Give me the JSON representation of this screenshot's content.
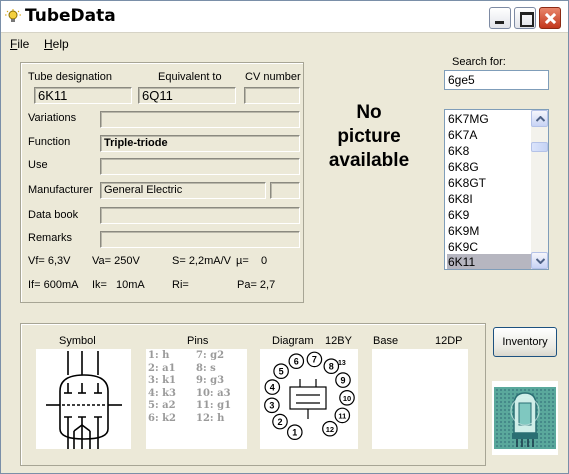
{
  "window": {
    "title": "TubeData",
    "controls": [
      "minimize",
      "maximize",
      "close"
    ]
  },
  "menu": [
    {
      "label": "File",
      "accel": "F",
      "rest": "ile"
    },
    {
      "label": "Help",
      "accel": "H",
      "rest": "elp"
    }
  ],
  "tube": {
    "designation_label": "Tube designation",
    "designation": "6K11",
    "equivalent_label": "Equivalent to",
    "equivalent": "6Q11",
    "cv_label": "CV number",
    "cv": "",
    "variations_label": "Variations",
    "variations": "",
    "function_label": "Function",
    "function": "Triple-triode",
    "use_label": "Use",
    "use": "",
    "manufacturer_label": "Manufacturer",
    "manufacturer": "General Electric",
    "manufacturer_code": "",
    "databook_label": "Data book",
    "databook": "",
    "remarks_label": "Remarks",
    "remarks": ""
  },
  "specs": {
    "vf": "Vf= 6,3V",
    "va": "Va= 250V",
    "s": "S= 2,2mA/V",
    "mu": "µ=",
    "mu_value": "0",
    "if": "If= 600mA",
    "ik": "Ik=",
    "ik_value": "10mA",
    "ri": "Ri=",
    "pa": "Pa= 2,7"
  },
  "picture": {
    "line1": "No",
    "line2": "picture",
    "line3": "available"
  },
  "search": {
    "label": "Search for:",
    "value": "6ge5"
  },
  "tube_list": {
    "items": [
      "6K7MG",
      "6K7A",
      "6K8",
      "6K8G",
      "6K8GT",
      "6K8I",
      "6K9",
      "6K9M",
      "6K9C",
      "6K11"
    ],
    "selected": "6K11"
  },
  "bottom": {
    "symbol_label": "Symbol",
    "pins_label": "Pins",
    "diagram_label": "Diagram",
    "diagram_code": "12BY",
    "base_label": "Base",
    "base_code": "12DP",
    "pins_left": [
      "1: h",
      "2: a1",
      "3: k1",
      "4: k3",
      "5: a2",
      "6: k2"
    ],
    "pins_right": [
      "7: g2",
      "8: s",
      "9: g3",
      "10: a3",
      "11: g1",
      "12: h"
    ],
    "diagram_pin_numbers": [
      "1",
      "2",
      "3",
      "4",
      "5",
      "6",
      "7",
      "8",
      "9",
      "10",
      "11",
      "12"
    ],
    "diagram_index_mark": "13"
  },
  "buttons": {
    "inventory": "Inventory"
  },
  "colors": {
    "window_bg": "#ece9d8",
    "close_red": "#c2371c",
    "list_selection": "#b6b6c0",
    "pins_text": "#9a9a9a"
  }
}
